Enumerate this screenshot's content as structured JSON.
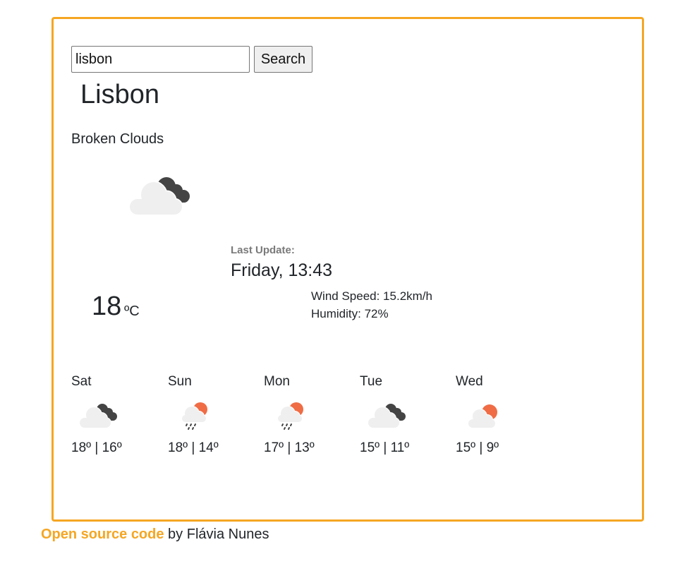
{
  "search": {
    "value": "lisbon",
    "button_label": "Search"
  },
  "current": {
    "city": "Lisbon",
    "description": "Broken Clouds",
    "icon": "broken-clouds-icon",
    "temperature": "18",
    "unit": "ºC",
    "last_update_label": "Last Update:",
    "last_update_value": "Friday, 13:43",
    "wind": "Wind Speed: 15.2km/h",
    "humidity": "Humidity: 72%"
  },
  "forecast": [
    {
      "day": "Sat",
      "icon": "broken-clouds-icon",
      "temps": "18º | 16º"
    },
    {
      "day": "Sun",
      "icon": "rain-sun-icon",
      "temps": "18º | 14º"
    },
    {
      "day": "Mon",
      "icon": "rain-sun-icon",
      "temps": "17º | 13º"
    },
    {
      "day": "Tue",
      "icon": "broken-clouds-icon",
      "temps": "15º | 11º"
    },
    {
      "day": "Wed",
      "icon": "partly-cloudy-icon",
      "temps": "15º | 9º"
    }
  ],
  "footer": {
    "link_text": "Open source code",
    "suffix": " by Flávia Nunes"
  },
  "colors": {
    "accent": "#f5a623",
    "sun": "#ef6c45",
    "dark_cloud": "#444444",
    "light_cloud": "#efefef"
  }
}
